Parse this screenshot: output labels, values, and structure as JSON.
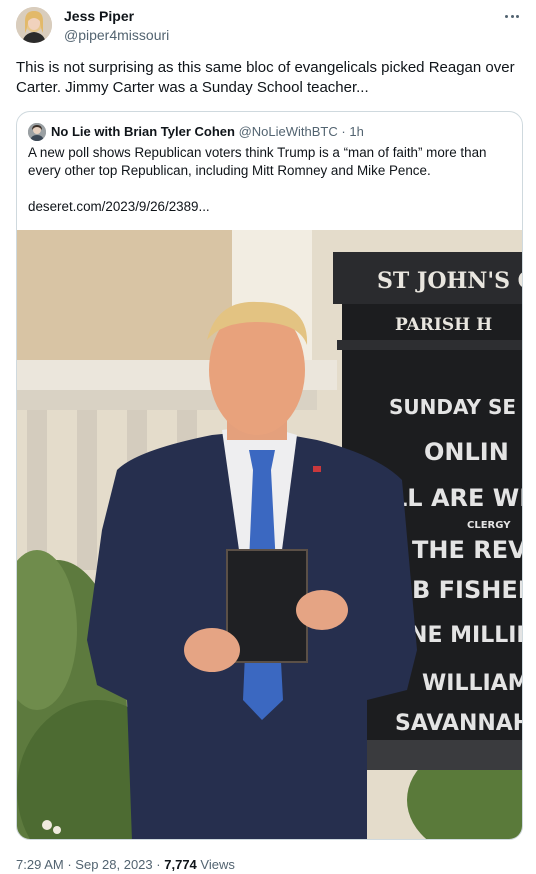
{
  "author": {
    "name": "Jess Piper",
    "handle": "@piper4missouri"
  },
  "tweet": {
    "text": "This is not surprising as this same bloc of evangelicals picked Reagan over Carter. Jimmy Carter was a Sunday School teacher..."
  },
  "quote": {
    "author_name": "No Lie with Brian Tyler Cohen",
    "handle": "@NoLieWithBTC",
    "separator": "·",
    "time": "1h",
    "text": "A new poll shows Republican voters think Trump is a “man of faith” more than every other top Republican, including Mitt Romney and Mike Pence.",
    "link": "deseret.com/2023/9/26/2389...",
    "image": {
      "sign_title_1": "ST JOHN'S C",
      "sign_title_2": "PARISH H",
      "sign_lines": [
        "SUNDAY SE",
        "ONLIN",
        "LL ARE WE",
        "CLERGY",
        "THE REVE",
        "B FISHER.",
        "ANE MILLIK",
        "WILLIAM",
        "SAVANNAH"
      ]
    }
  },
  "footer": {
    "time": "7:29 AM",
    "separator1": "·",
    "date": "Sep 28, 2023",
    "separator2": "·",
    "views_count": "7,774",
    "views_label": "Views"
  },
  "icons": {
    "more": "more-horizontal-icon"
  }
}
